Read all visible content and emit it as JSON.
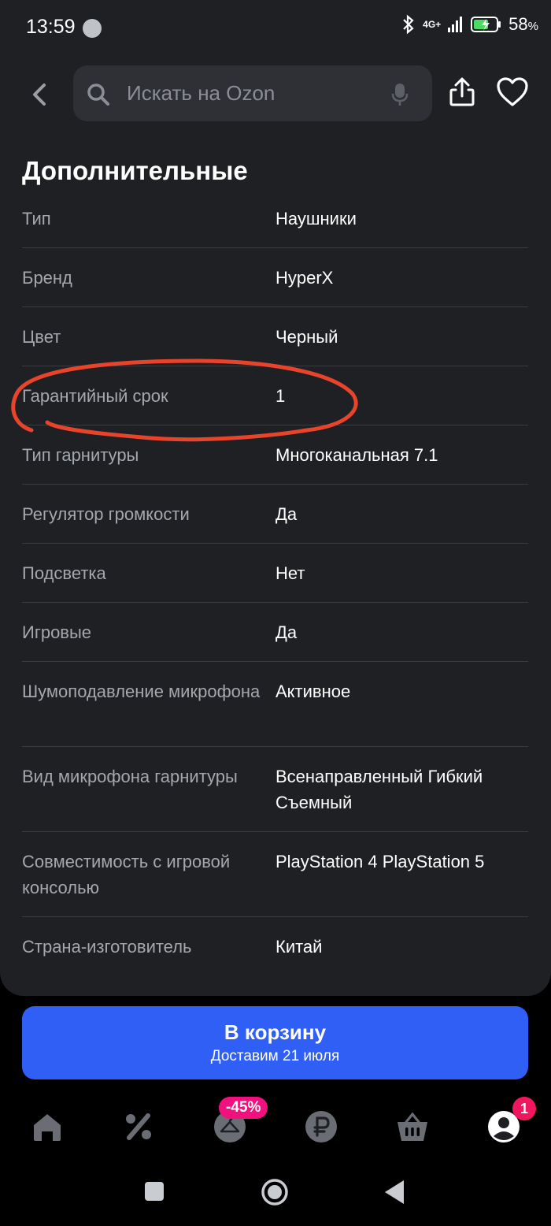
{
  "status_bar": {
    "time": "13:59",
    "network": "4G+",
    "battery_percent": "58",
    "battery_unit": "%"
  },
  "header": {
    "search_placeholder": "Искать на Ozon"
  },
  "section": {
    "title": "Дополнительные"
  },
  "specs": [
    {
      "key": "Тип",
      "value": "Наушники"
    },
    {
      "key": "Бренд",
      "value": "HyperX"
    },
    {
      "key": "Цвет",
      "value": "Черный"
    },
    {
      "key": "Гарантийный срок",
      "value": "1"
    },
    {
      "key": "Тип гарнитуры",
      "value": "Многоканальная 7.1"
    },
    {
      "key": "Регулятор громкости",
      "value": "Да"
    },
    {
      "key": "Подсветка",
      "value": "Нет"
    },
    {
      "key": "Игровые",
      "value": "Да"
    },
    {
      "key": "Шумоподавление микрофона",
      "value": "Активное"
    },
    {
      "key": "Вид микрофона гарнитуры",
      "value": "Всенаправленный Гибкий Съемный"
    },
    {
      "key": "Совместимость с игровой консолью",
      "value": "PlayStation 4 PlayStation 5"
    },
    {
      "key": "Страна-изготовитель",
      "value": "Китай"
    }
  ],
  "cart_button": {
    "title": "В корзину",
    "subtitle": "Доставим 21 июля"
  },
  "tabbar": {
    "sale_badge": "-45%",
    "profile_badge": "1"
  },
  "colors": {
    "background": "#1f2023",
    "accent": "#2f5ff5",
    "badge": "#f1117e",
    "annotation": "#e8432b"
  }
}
